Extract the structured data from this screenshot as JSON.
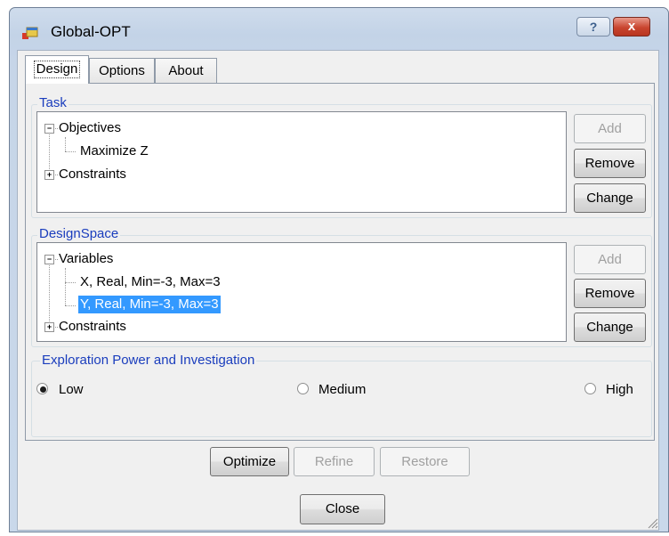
{
  "window": {
    "title": "Global-OPT",
    "help_label": "?",
    "close_label": "x"
  },
  "tabs": [
    {
      "label": "Design",
      "selected": true
    },
    {
      "label": "Options",
      "selected": false
    },
    {
      "label": "About",
      "selected": false
    }
  ],
  "task": {
    "title": "Task",
    "tree": {
      "objectives": "Objectives",
      "objective_item": "Maximize Z",
      "constraints": "Constraints"
    },
    "buttons": {
      "add": "Add",
      "remove": "Remove",
      "change": "Change"
    }
  },
  "design_space": {
    "title": "DesignSpace",
    "tree": {
      "variables": "Variables",
      "var_x": "X, Real, Min=-3, Max=3",
      "var_y": "Y, Real, Min=-3, Max=3",
      "constraints": "Constraints"
    },
    "buttons": {
      "add": "Add",
      "remove": "Remove",
      "change": "Change"
    }
  },
  "exploration": {
    "title": "Exploration Power and Investigation",
    "options": [
      {
        "label": "Low",
        "checked": true
      },
      {
        "label": "Medium",
        "checked": false
      },
      {
        "label": "High",
        "checked": false
      }
    ]
  },
  "actions": {
    "optimize": "Optimize",
    "refine": "Refine",
    "restore": "Restore"
  },
  "footer": {
    "close": "Close"
  },
  "colors": {
    "accent_text": "#1a3dbd",
    "selection": "#3399ff",
    "close_button": "#c9452f"
  }
}
